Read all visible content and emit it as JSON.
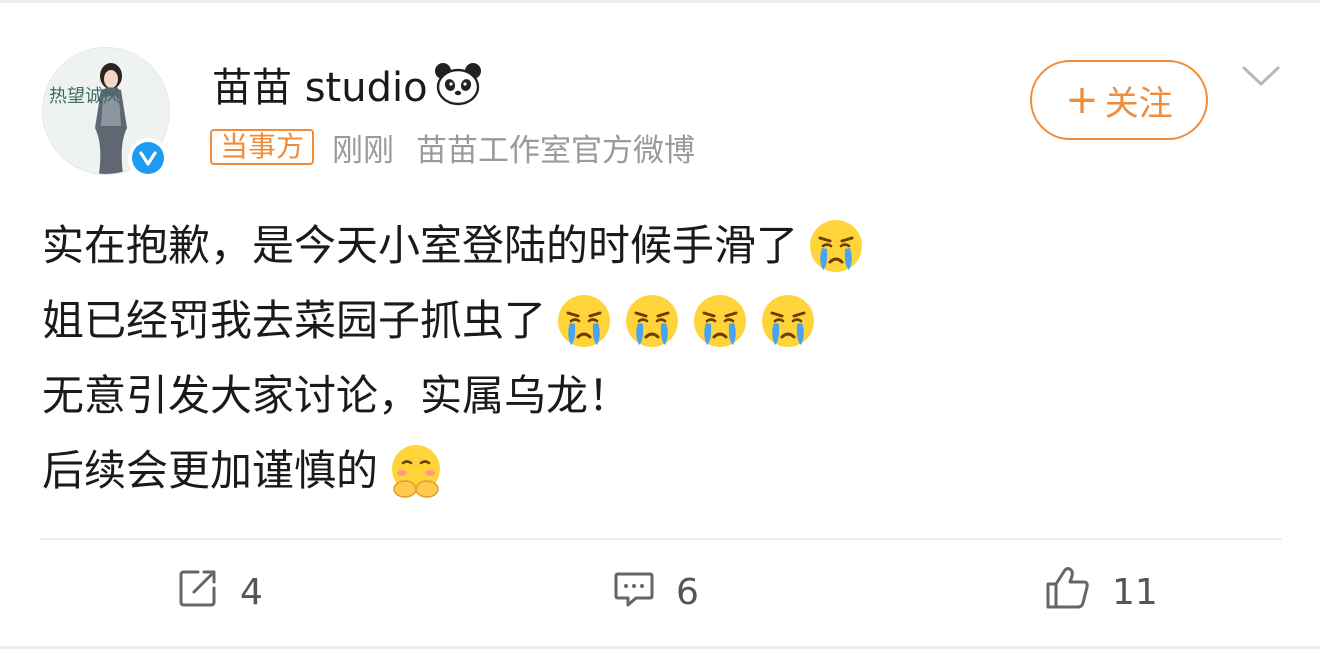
{
  "post": {
    "author": {
      "name": "苗苗 studio",
      "avatar_text": "热望诚风",
      "badge_icon": "panda-icon",
      "verified_icon": "verified-check-icon"
    },
    "party_tag": "当事方",
    "time": "刚刚",
    "source": "苗苗工作室官方微博",
    "follow_label": "关注",
    "follow_plus": "+",
    "lines": [
      "实在抱歉，是今天小室登陆的时候手滑了",
      "姐已经罚我去菜园子抓虫了",
      "无意引发大家讨论，实属乌龙！",
      "后续会更加谨慎的"
    ],
    "line_emojis": [
      [
        "crying-emoji"
      ],
      [
        "crying-emoji",
        "crying-emoji",
        "crying-emoji",
        "crying-emoji"
      ],
      [],
      [
        "shy-emoji"
      ]
    ]
  },
  "actions": {
    "repost": {
      "icon": "repost-icon",
      "count": "4"
    },
    "comment": {
      "icon": "comment-icon",
      "count": "6"
    },
    "like": {
      "icon": "thumbs-up-icon",
      "count": "11"
    }
  },
  "colors": {
    "accent": "#f08c3a",
    "verified": "#1e9bf0",
    "meta_text": "#9a9a9a"
  }
}
